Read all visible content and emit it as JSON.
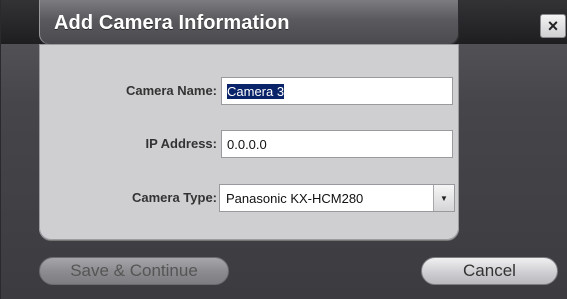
{
  "dialog": {
    "title": "Add Camera Information",
    "close_glyph": "×"
  },
  "form": {
    "camera_name": {
      "label": "Camera Name:",
      "value": "Camera 3"
    },
    "ip_address": {
      "label": "IP Address:",
      "value": "0.0.0.0"
    },
    "camera_type": {
      "label": "Camera Type:",
      "value": "Panasonic KX-HCM280",
      "arrow": "▼"
    }
  },
  "buttons": {
    "save_label": "Save & Continue",
    "cancel_label": "Cancel"
  }
}
